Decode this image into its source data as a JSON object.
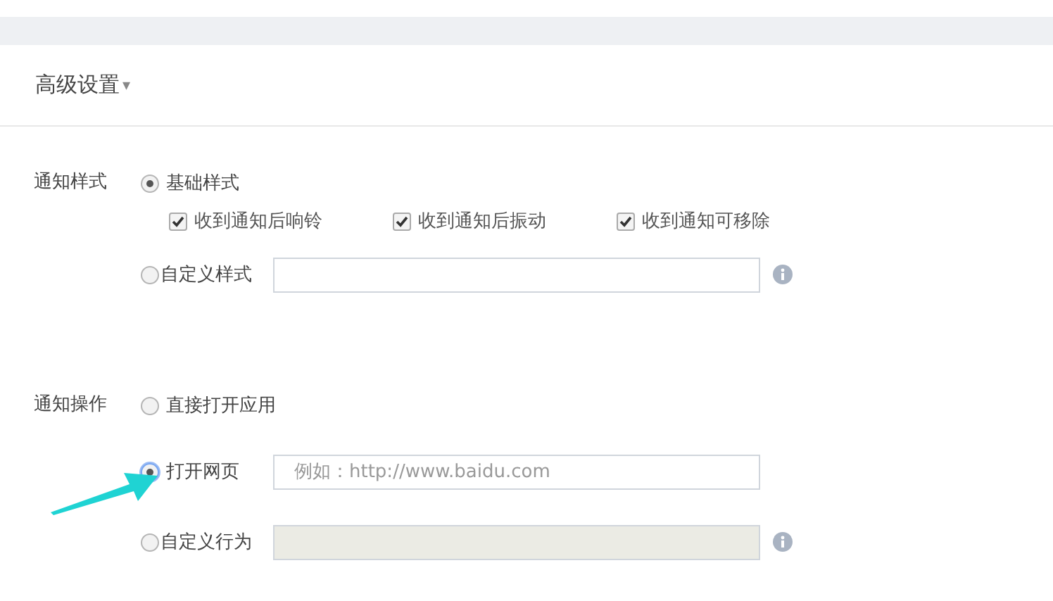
{
  "section": {
    "title": "高级设置",
    "caret": "▾"
  },
  "groups": [
    {
      "label": "通知样式",
      "options": [
        {
          "kind": "radio",
          "label": "基础样式",
          "selected": true,
          "checkboxes": [
            {
              "label": "收到通知后响铃",
              "checked": true
            },
            {
              "label": "收到通知后振动",
              "checked": true
            },
            {
              "label": "收到通知可移除",
              "checked": true
            }
          ]
        },
        {
          "kind": "radio-field",
          "label": "自定义样式",
          "selected": false,
          "field": {
            "disabled": false
          },
          "info": true
        }
      ]
    },
    {
      "label": "通知操作",
      "options": [
        {
          "kind": "radio",
          "label": "直接打开应用",
          "selected": false
        },
        {
          "kind": "radio-field",
          "label": "打开网页",
          "selected": true,
          "focused": true,
          "field": {
            "placeholder": "例如：http://www.baidu.com",
            "disabled": false
          },
          "info": false,
          "arrow": true
        },
        {
          "kind": "radio-field",
          "label": "自定义行为",
          "selected": false,
          "field": {
            "disabled": true
          },
          "info": true
        }
      ]
    }
  ]
}
